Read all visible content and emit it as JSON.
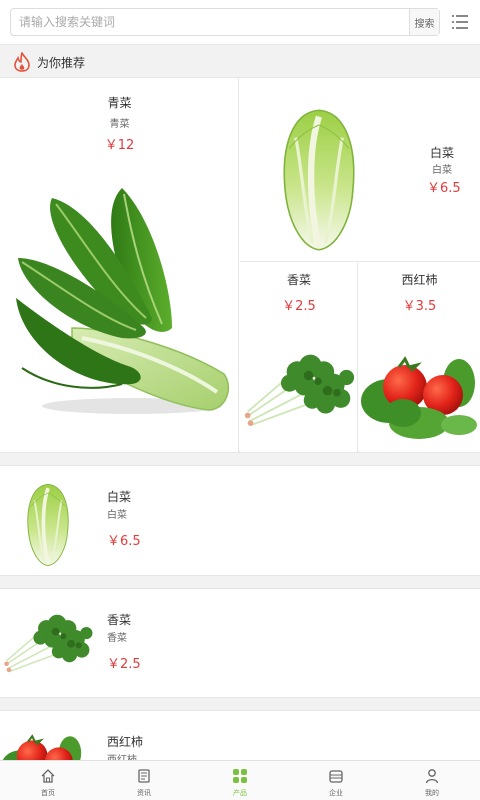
{
  "search": {
    "placeholder": "请输入搜索关键词",
    "button_label": "搜索"
  },
  "section": {
    "title": "为你推荐"
  },
  "featured": [
    {
      "name": "青菜",
      "sub": "青菜",
      "price": "￥12"
    },
    {
      "name": "白菜",
      "sub": "白菜",
      "price": "￥6.5"
    },
    {
      "name": "香菜",
      "price": "￥2.5"
    },
    {
      "name": "西红柿",
      "price": "￥3.5"
    }
  ],
  "list": [
    {
      "name": "白菜",
      "sub": "白菜",
      "price": "￥6.5"
    },
    {
      "name": "香菜",
      "sub": "香菜",
      "price": "￥2.5"
    },
    {
      "name": "西红柿",
      "sub": "西红柿"
    }
  ],
  "tabs": [
    {
      "label": "首页",
      "icon": "home-icon"
    },
    {
      "label": "资讯",
      "icon": "news-icon"
    },
    {
      "label": "产品",
      "icon": "grid-icon",
      "active": true
    },
    {
      "label": "企业",
      "icon": "company-icon"
    },
    {
      "label": "我的",
      "icon": "user-icon"
    }
  ],
  "colors": {
    "price": "#e23c3c",
    "active_tab": "#7bc043",
    "fire": "#e2533c"
  }
}
